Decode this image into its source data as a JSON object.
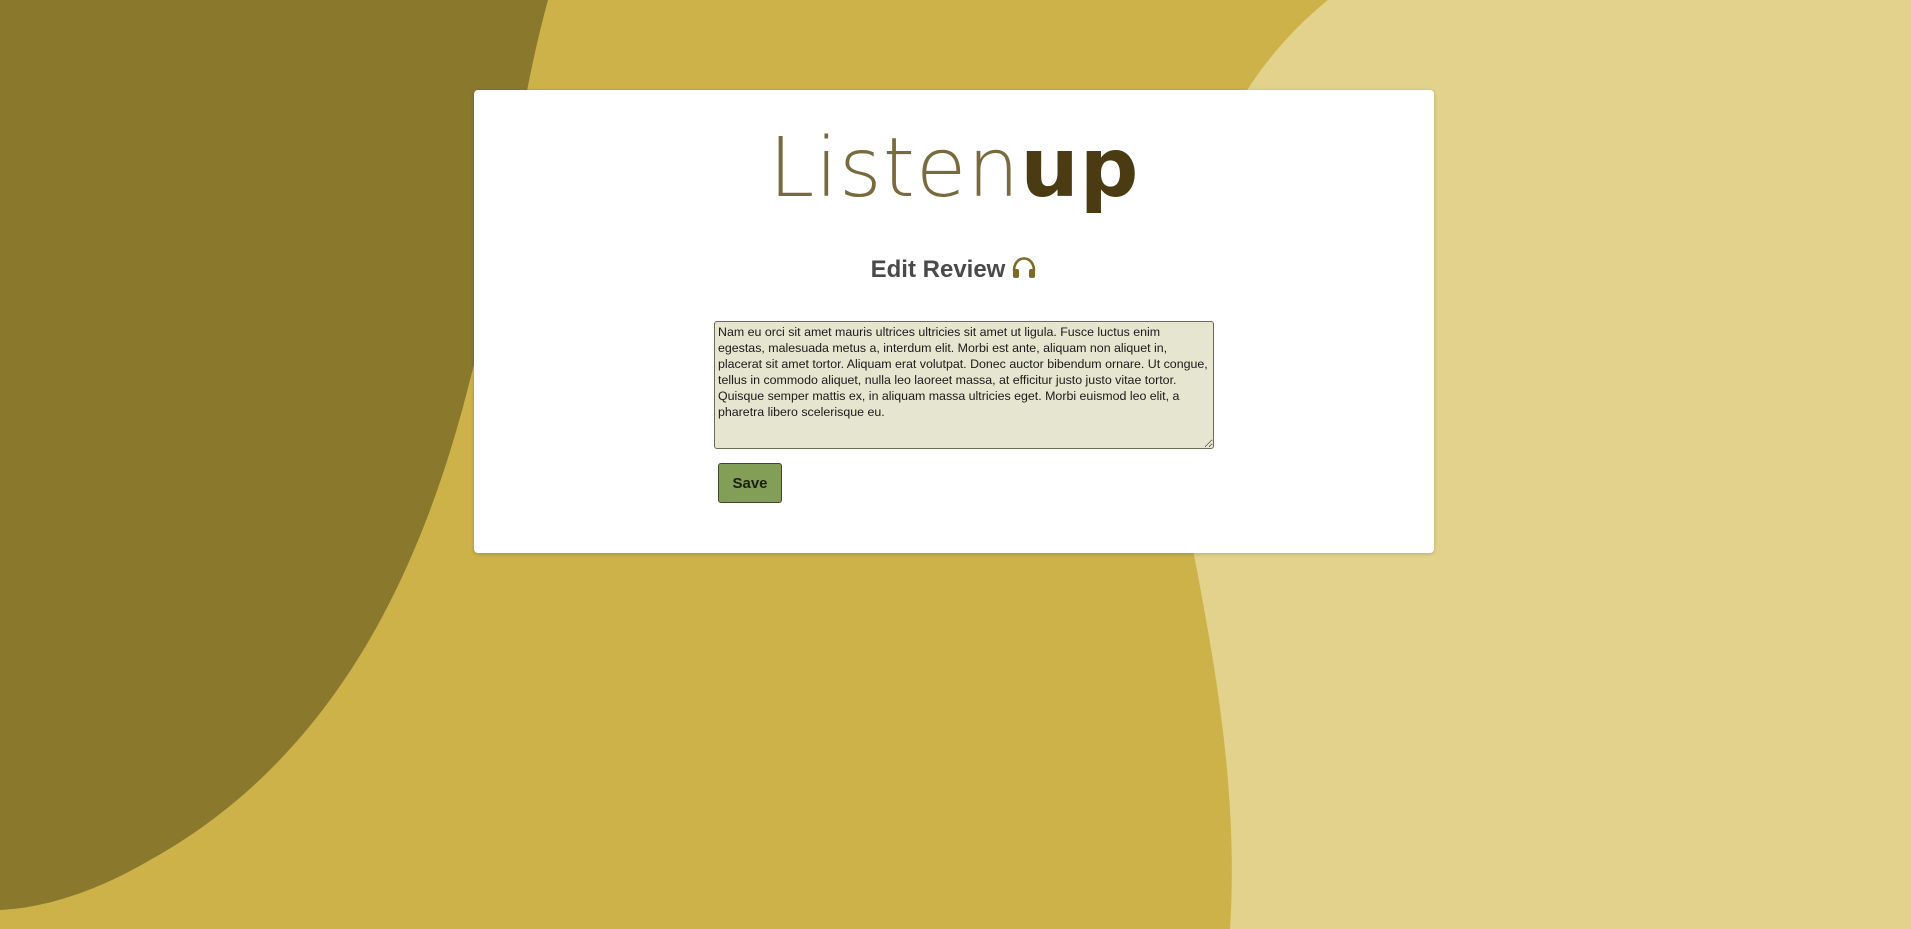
{
  "brand": {
    "light_part": "Listen",
    "bold_part": "up"
  },
  "page": {
    "heading": "Edit Review",
    "heading_icon": "headphones-icon"
  },
  "form": {
    "review_text": "Nam eu orci sit amet mauris ultrices ultricies sit amet ut ligula. Fusce luctus enim egestas, malesuada metus a, interdum elit. Morbi est ante, aliquam non aliquet in, placerat sit amet tortor. Aliquam erat volutpat. Donec auctor bibendum ornare. Ut congue, tellus in commodo aliquet, nulla leo laoreet massa, at efficitur justo justo vitae tortor. Quisque semper mattis ex, in aliquam massa ultricies eget. Morbi euismod leo elit, a pharetra libero scelerisque eu.",
    "save_label": "Save"
  },
  "colors": {
    "background_dark": "#8a792c",
    "background_mid": "#cdb249",
    "background_light": "#e2d28c",
    "card": "#ffffff",
    "textarea_bg": "#e6e5cf",
    "save_button": "#839e57",
    "brand_bold": "#4b3b12"
  }
}
